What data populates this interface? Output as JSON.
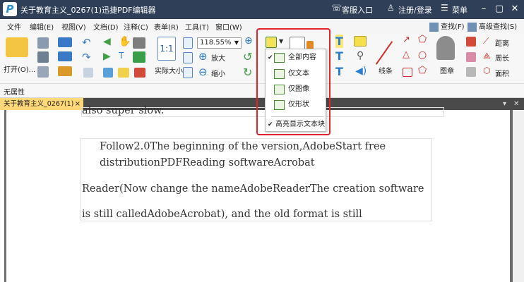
{
  "window": {
    "title": "关于教育主义_0267(1)迅捷PDF编辑器",
    "logo": "P",
    "service": "客服入口",
    "login": "注册/登录",
    "menu": "菜单"
  },
  "menubar": {
    "items": [
      "文件",
      "编辑(E)",
      "视图(V)",
      "文档(D)",
      "注释(C)",
      "表单(R)",
      "工具(T)",
      "窗口(W)"
    ],
    "find": "查找(F)",
    "advanced_find": "高级查找(S)"
  },
  "toolbar": {
    "open": "打开(O)...",
    "actual_size": "实际大小",
    "zoom_value": "118.55%",
    "zoom_in": "放大",
    "zoom_out": "缩小",
    "line": "线条",
    "stamp": "图章",
    "distance": "距离",
    "perimeter": "周长",
    "area": "面积"
  },
  "dropdown": {
    "items": [
      {
        "label": "全部内容",
        "checked": true
      },
      {
        "label": "仅文本",
        "checked": false
      },
      {
        "label": "仅图像",
        "checked": false
      },
      {
        "label": "仅形状",
        "checked": false
      }
    ],
    "highlight": {
      "label": "高亮显示文本块",
      "checked": true
    }
  },
  "propbar": {
    "label": "无属性"
  },
  "tab": {
    "name": "关于教育主义_0267(1)",
    "close": "×"
  },
  "document": {
    "lines": [
      "also super slow.",
      "Follow2.0The beginning of the version,AdobeStart free",
      "distributionPDFReading softwareAcrobat",
      "Reader(Now change the nameAdobeReaderThe creation software",
      "is still calledAdobeAcrobat), and the old format is still"
    ]
  },
  "colors": {
    "titlebar": "#2f3f57",
    "tab_active": "#ffd87a",
    "highlight_frame": "#e0242a"
  }
}
